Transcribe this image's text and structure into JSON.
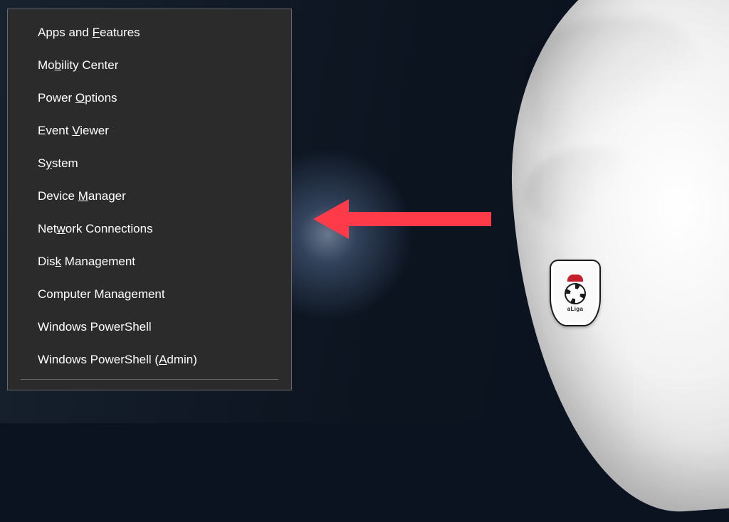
{
  "menu": {
    "items": [
      {
        "id": "apps-and-features",
        "pre": "Apps and ",
        "accel": "F",
        "post": "eatures"
      },
      {
        "id": "mobility-center",
        "pre": "Mo",
        "accel": "b",
        "post": "ility Center"
      },
      {
        "id": "power-options",
        "pre": "Power ",
        "accel": "O",
        "post": "ptions"
      },
      {
        "id": "event-viewer",
        "pre": "Event ",
        "accel": "V",
        "post": "iewer"
      },
      {
        "id": "system",
        "pre": "S",
        "accel": "y",
        "post": "stem"
      },
      {
        "id": "device-manager",
        "pre": "Device ",
        "accel": "M",
        "post": "anager"
      },
      {
        "id": "network-connections",
        "pre": "Net",
        "accel": "w",
        "post": "ork Connections"
      },
      {
        "id": "disk-management",
        "pre": "Dis",
        "accel": "k",
        "post": " Management"
      },
      {
        "id": "computer-management",
        "pre": "Computer Mana",
        "accel": "g",
        "post": "ement"
      },
      {
        "id": "windows-powershell",
        "pre": "Windows PowerShell",
        "accel": "",
        "post": ""
      },
      {
        "id": "windows-powershell-admin",
        "pre": "Windows PowerShell (",
        "accel": "A",
        "post": "dmin)"
      }
    ]
  },
  "badge": {
    "text": "aLiga"
  },
  "annotation": {
    "arrow_color": "#ff3b4a"
  }
}
